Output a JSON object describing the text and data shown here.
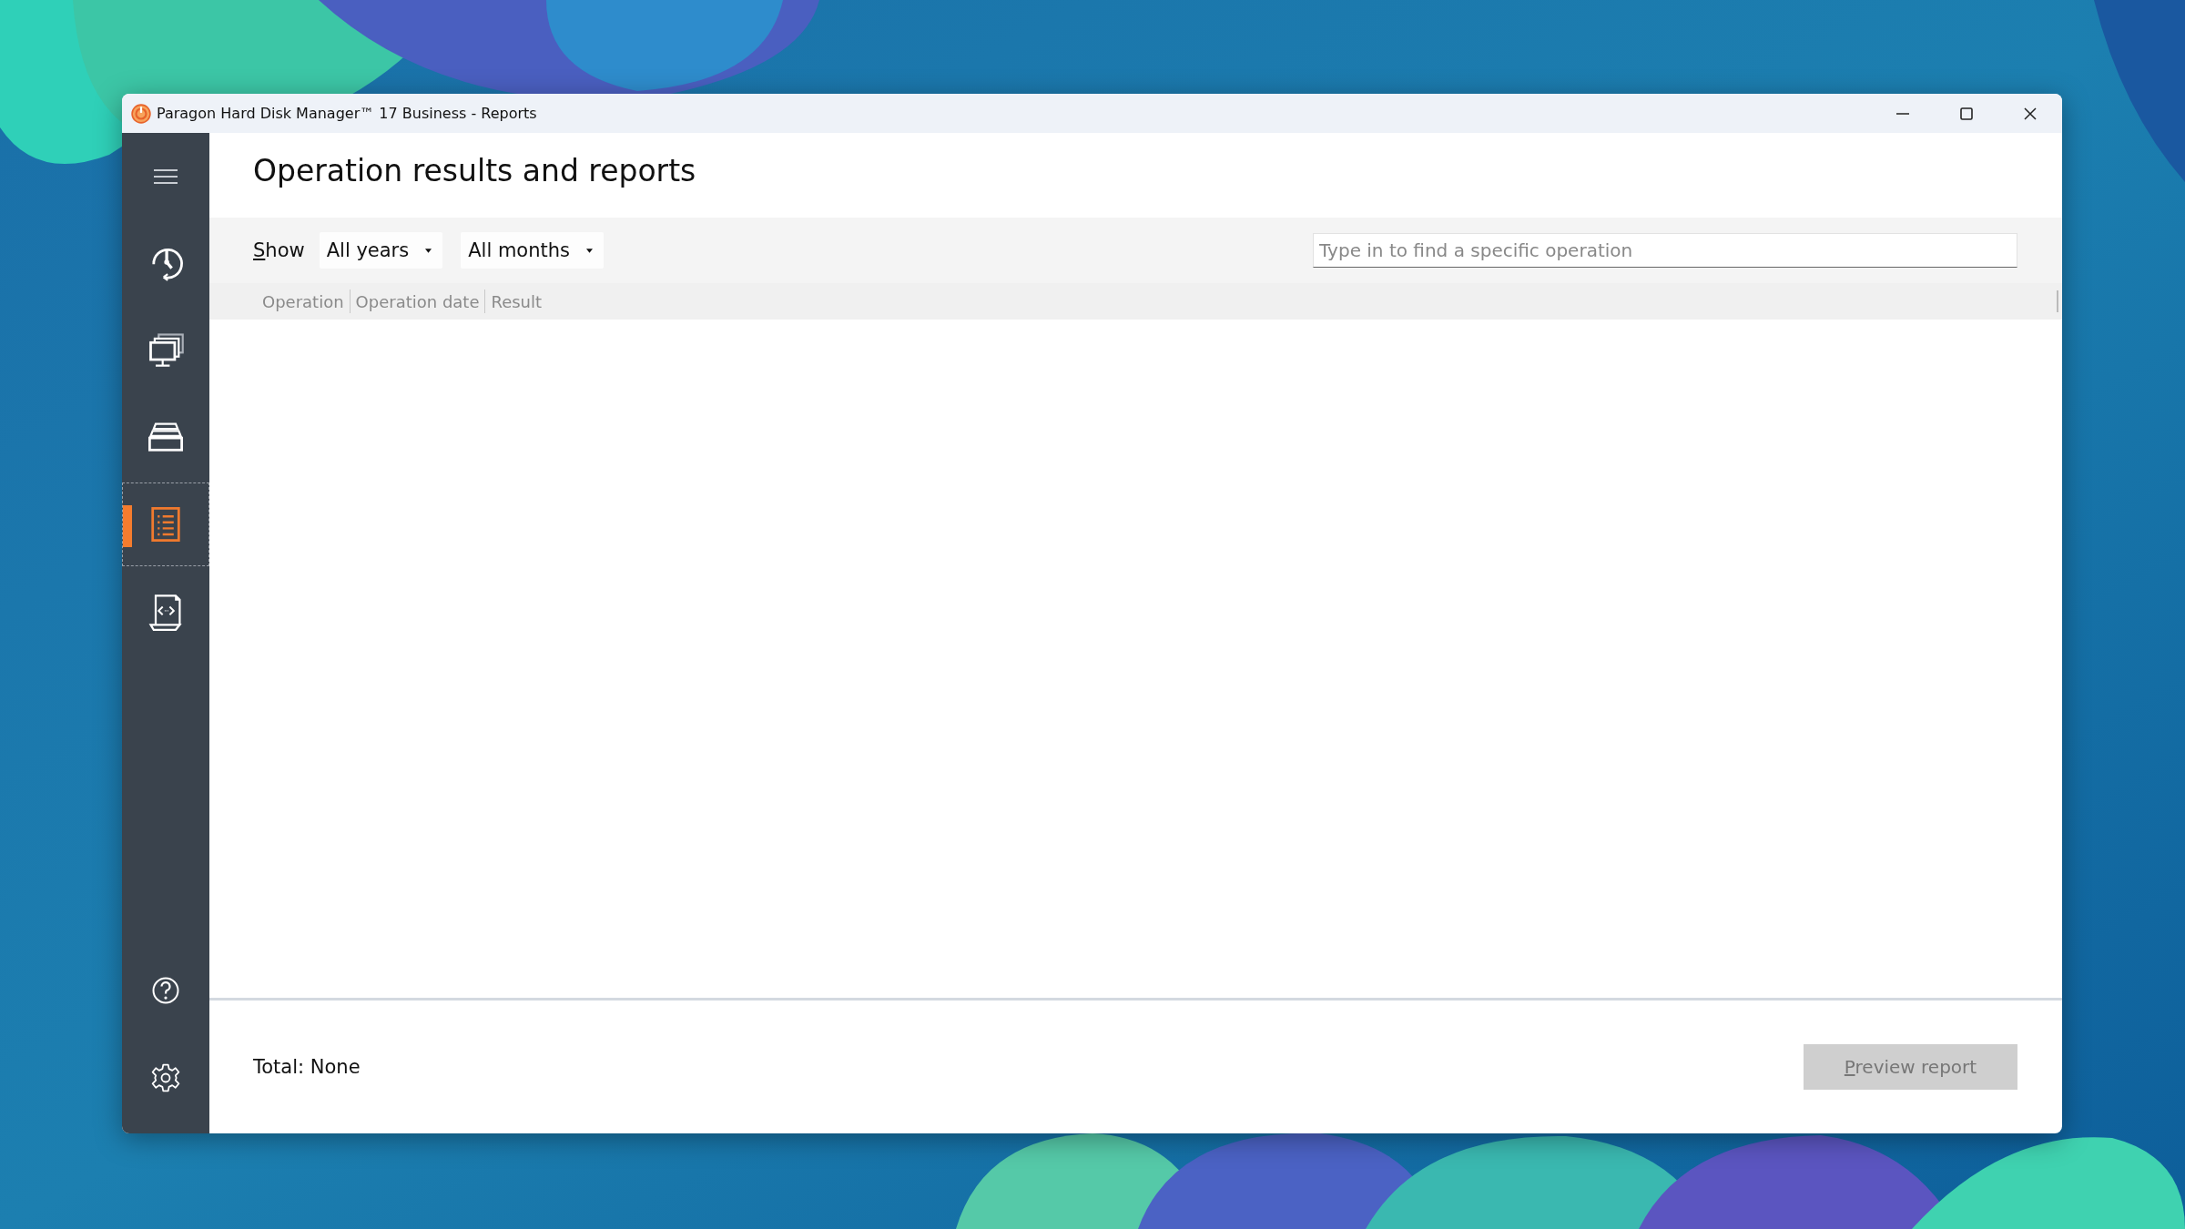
{
  "window": {
    "title": "Paragon Hard Disk Manager™ 17 Business - Reports"
  },
  "sidebar": {
    "items": [
      {
        "kind": "history",
        "selected": false
      },
      {
        "kind": "computers",
        "selected": false
      },
      {
        "kind": "disks",
        "selected": false
      },
      {
        "kind": "reports",
        "selected": true
      },
      {
        "kind": "scripts",
        "selected": false
      }
    ],
    "bottom_items": [
      {
        "kind": "help",
        "selected": false
      },
      {
        "kind": "settings",
        "selected": false
      }
    ]
  },
  "page": {
    "title": "Operation results and reports"
  },
  "filters": {
    "label": "Show",
    "dropdowns": [
      {
        "value": "All years"
      },
      {
        "value": "All months"
      }
    ],
    "search": {
      "placeholder": "Type in to find a specific operation"
    }
  },
  "table": {
    "columns": [
      "Operation",
      "Operation date",
      "Result"
    ]
  },
  "footer": {
    "total": "Total: None",
    "button": {
      "label": "Preview report",
      "disabled": true
    }
  }
}
